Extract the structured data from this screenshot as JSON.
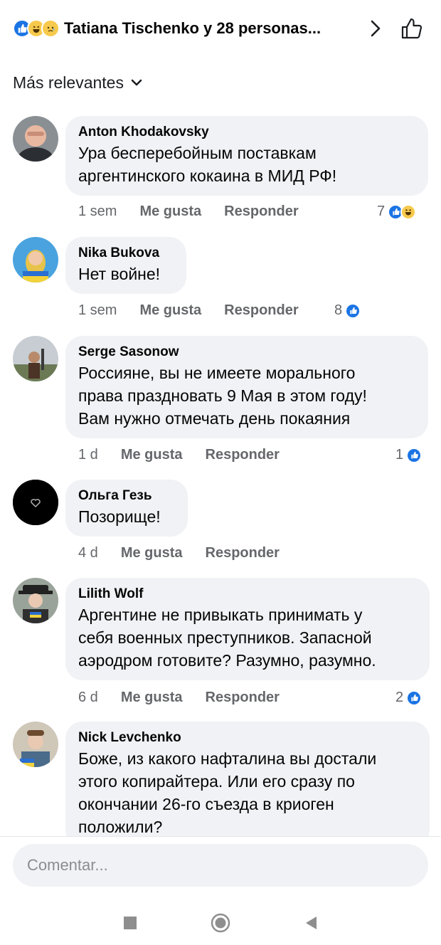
{
  "header": {
    "title": "Tatiana Tischenko y 28 personas...",
    "reaction_icons": [
      "like-icon",
      "haha-icon",
      "sad-icon"
    ]
  },
  "sort": {
    "label": "Más relevantes"
  },
  "comments": [
    {
      "author": "Anton Khodakovsky",
      "lines": [
        "Ура бесперебойным поставкам",
        "аргентинского кокаина в МИД РФ!"
      ],
      "time": "1 sem",
      "like_label": "Me gusta",
      "reply_label": "Responder",
      "reactions": "7",
      "reaction_icons": [
        "like-icon",
        "haha-icon"
      ]
    },
    {
      "author": "Nika Bukova",
      "lines": [
        "Нет войне!"
      ],
      "time": "1 sem",
      "like_label": "Me gusta",
      "reply_label": "Responder",
      "reactions": "8",
      "reaction_icons": [
        "like-icon"
      ]
    },
    {
      "author": "Serge Sasonow",
      "lines": [
        "Россияне, вы не имеете морального",
        "права праздновать 9 Мая в этом году!",
        "Вам нужно отмечать день покаяния"
      ],
      "time": "1 d",
      "like_label": "Me gusta",
      "reply_label": "Responder",
      "reactions": "1",
      "reaction_icons": [
        "like-icon"
      ]
    },
    {
      "author": "Ольга Гезь",
      "lines": [
        "Позорище!"
      ],
      "time": "4 d",
      "like_label": "Me gusta",
      "reply_label": "Responder",
      "reactions": "",
      "reaction_icons": []
    },
    {
      "author": "Lilith Wolf",
      "lines": [
        "Аргентине не привыкать принимать у",
        "себя военных преступников. Запасной",
        "аэродром готовите? Разумно, разумно."
      ],
      "time": "6 d",
      "like_label": "Me gusta",
      "reply_label": "Responder",
      "reactions": "2",
      "reaction_icons": [
        "like-icon"
      ]
    },
    {
      "author": "Nick Levchenko",
      "lines": [
        "Боже, из какого нафталина вы достали",
        "этого копирайтера. Или его сразу по",
        "окончании 26-го съезда в криоген",
        "положили?"
      ],
      "time": "",
      "like_label": "",
      "reply_label": "",
      "reactions": "",
      "reaction_icons": []
    }
  ],
  "composer": {
    "placeholder": "Comentar..."
  },
  "colors": {
    "like": "#1b74e4",
    "haha": "#f7c94c",
    "bubble": "#f0f2f5",
    "meta": "#65676b"
  },
  "nav": [
    "recent-apps-icon",
    "home-icon",
    "back-icon"
  ]
}
